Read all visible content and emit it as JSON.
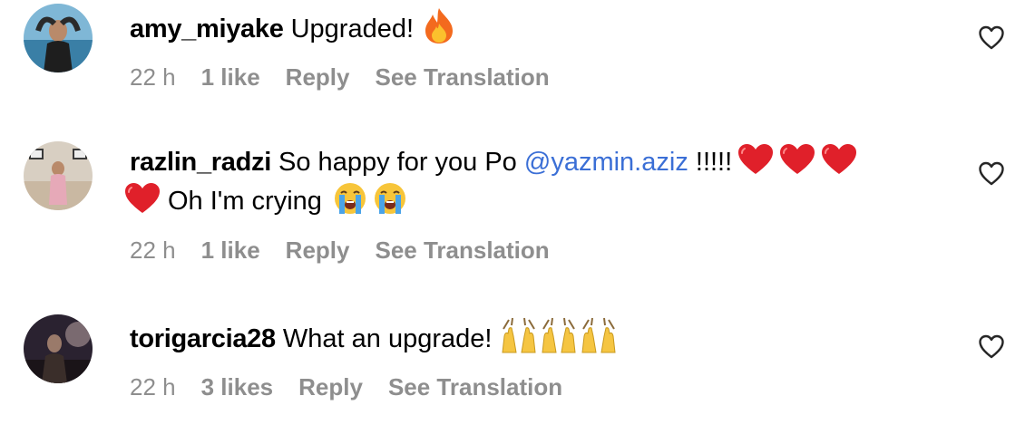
{
  "comments": [
    {
      "username": "amy_miyake",
      "text": "Upgraded!",
      "emoji_icons": [
        "fire-icon"
      ],
      "time": "22 h",
      "likes": "1 like",
      "reply": "Reply",
      "translate": "See Translation"
    },
    {
      "username": "razlin_radzi",
      "text_before": "So happy for you Po",
      "mention": "@yazmin.aziz",
      "text_after": "!!!!!",
      "text_line2": "Oh I'm crying",
      "emoji_icons": [
        "red-heart-icon",
        "red-heart-icon",
        "red-heart-icon",
        "red-heart-icon",
        "loudly-crying-face-icon",
        "loudly-crying-face-icon"
      ],
      "time": "22 h",
      "likes": "1 like",
      "reply": "Reply",
      "translate": "See Translation"
    },
    {
      "username": "torigarcia28",
      "text": "What an upgrade!",
      "emoji_icons": [
        "raising-hands-icon",
        "raising-hands-icon",
        "raising-hands-icon"
      ],
      "time": "22 h",
      "likes": "3 likes",
      "reply": "Reply",
      "translate": "See Translation"
    }
  ],
  "colors": {
    "mention": "#3b6fd6",
    "meta_text": "#8e8e8e",
    "heart_red": "#e0202a"
  }
}
